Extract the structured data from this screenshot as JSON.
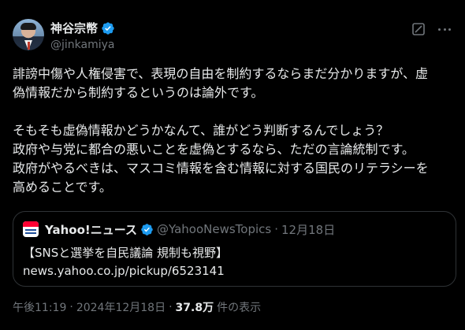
{
  "author": {
    "display_name": "神谷宗幣",
    "handle": "@jinkamiya",
    "verified": true
  },
  "icons": {
    "verified": "verified-badge-icon",
    "grok": "grok-icon",
    "more": "more-options-icon",
    "quote_source_logo": "yahoo-news-logo"
  },
  "colors": {
    "background": "#000000",
    "text": "#e7e9ea",
    "muted": "#71767b",
    "verified_blue": "#1d9bf0",
    "border": "#2f3336"
  },
  "post": {
    "lines": [
      "誹謗中傷や人権侵害で、表現の自由を制約するならまだ分かりますが、虚",
      "偽情報だから制約するというのは論外です。",
      "",
      "そもそも虚偽情報かどうかなんて、誰がどう判断するんでしょう？",
      "政府や与党に都合の悪いことを虚偽とするなら、ただの言論統制です。",
      "政府がやるべきは、マスコミ情報を含む情報に対する国民のリテラシーを",
      "高めることです。"
    ]
  },
  "quote": {
    "display_name": "Yahoo!ニュース",
    "handle": "@YahooNewsTopics",
    "separator": "·",
    "date": "12月18日",
    "title": "【SNSと選挙を自民議論 規制も視野】",
    "link": "news.yahoo.co.jp/pickup/6523141"
  },
  "meta": {
    "time": "午後11:19",
    "sep1": "·",
    "date": "2024年12月18日",
    "sep2": "·",
    "views_count": "37.8万",
    "views_label": "件の表示"
  }
}
